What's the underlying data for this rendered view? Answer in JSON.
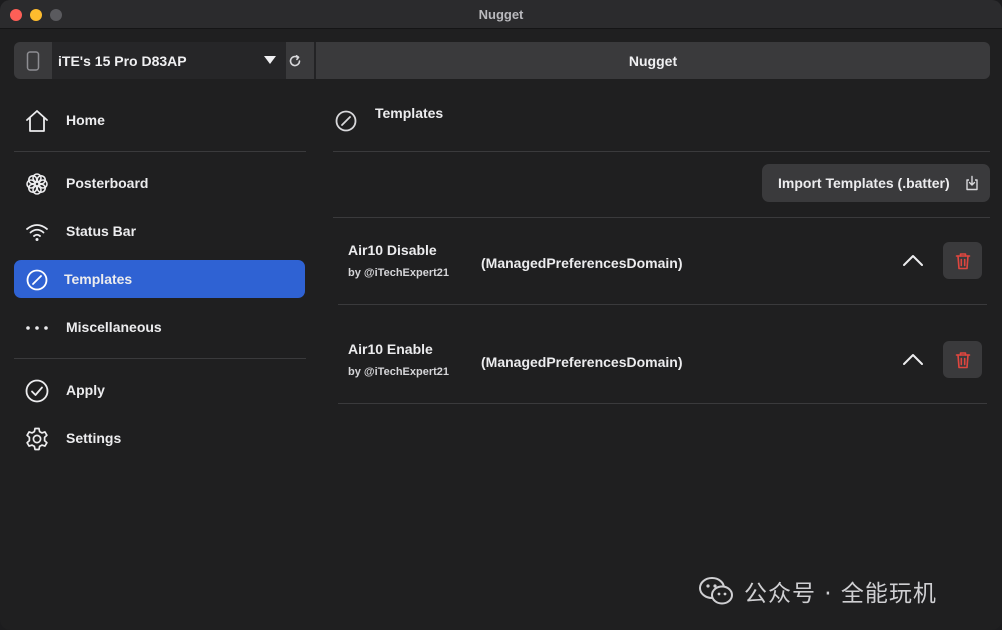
{
  "window": {
    "title": "Nugget"
  },
  "toolbar": {
    "device_name": "iTE's 15 Pro D83AP",
    "app_label": "Nugget"
  },
  "sidebar": {
    "items": [
      {
        "id": "home",
        "label": "Home",
        "icon": "home-icon",
        "active": false
      },
      {
        "id": "posterboard",
        "label": "Posterboard",
        "icon": "flower-icon",
        "active": false
      },
      {
        "id": "status-bar",
        "label": "Status Bar",
        "icon": "wifi-icon",
        "active": false
      },
      {
        "id": "templates",
        "label": "Templates",
        "icon": "gauge-icon",
        "active": true
      },
      {
        "id": "miscellaneous",
        "label": "Miscellaneous",
        "icon": "ellipsis-icon",
        "active": false
      },
      {
        "id": "apply",
        "label": "Apply",
        "icon": "checkmark-circle-icon",
        "active": false
      },
      {
        "id": "settings",
        "label": "Settings",
        "icon": "gear-icon",
        "active": false
      }
    ]
  },
  "main": {
    "title": "Templates",
    "import_label": "Import Templates (.batter)",
    "templates": [
      {
        "name": "Air10 Disable",
        "author": "by @iTechExpert21",
        "domain": "(ManagedPreferencesDomain)"
      },
      {
        "name": "Air10 Enable",
        "author": "by @iTechExpert21",
        "domain": "(ManagedPreferencesDomain)"
      }
    ]
  },
  "watermark": {
    "text": "公众号 · 全能玩机"
  },
  "colors": {
    "accent": "#2f62d3",
    "delete": "#e0463f",
    "background": "#1f1f20",
    "panel": "#3a3a3c"
  }
}
